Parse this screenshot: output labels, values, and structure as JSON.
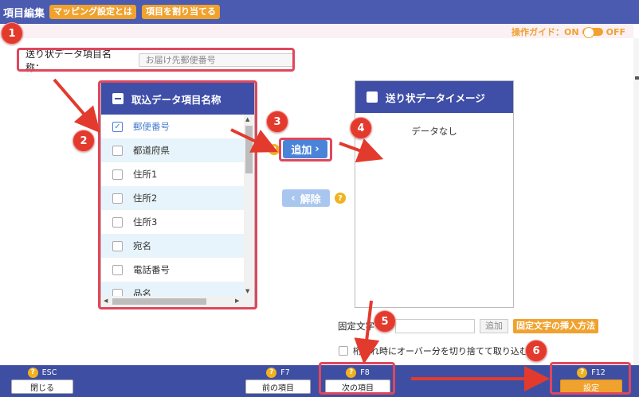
{
  "header": {
    "title": "項目編集",
    "mapping_button": "マッピング設定とは",
    "assign_button": "項目を割り当てる"
  },
  "guide": {
    "label": "操作ガイド：ON",
    "off_label": "OFF"
  },
  "name_field": {
    "label": "送り状データ項目名称：",
    "placeholder": "お届け先郵便番号"
  },
  "left_panel": {
    "title": "取込データ項目名称",
    "items": [
      {
        "label": "郵便番号",
        "checked": true
      },
      {
        "label": "都道府県",
        "checked": false
      },
      {
        "label": "住所1",
        "checked": false
      },
      {
        "label": "住所2",
        "checked": false
      },
      {
        "label": "住所3",
        "checked": false
      },
      {
        "label": "宛名",
        "checked": false
      },
      {
        "label": "電話番号",
        "checked": false
      },
      {
        "label": "品名",
        "checked": false
      }
    ]
  },
  "right_panel": {
    "title": "送り状データイメージ",
    "empty_text": "データなし"
  },
  "actions": {
    "add_label": "追加",
    "remove_label": "解除"
  },
  "fixed_text": {
    "label": "固定文字",
    "add_label": "追加",
    "howto_label": "固定文字の挿入方法",
    "truncate_label": "桁溢れ時にオーバー分を切り捨てて取り込む"
  },
  "footer": {
    "esc": {
      "key": "ESC",
      "label": "閉じる"
    },
    "f7": {
      "key": "F7",
      "label": "前の項目"
    },
    "f8": {
      "key": "F8",
      "label": "次の項目"
    },
    "f12": {
      "key": "F12",
      "label": "設定"
    }
  },
  "steps": [
    "1",
    "2",
    "3",
    "4",
    "5",
    "6"
  ],
  "colors": {
    "primary": "#3f4fa8",
    "accent": "#f0a22e",
    "callout": "#e23b2e"
  }
}
